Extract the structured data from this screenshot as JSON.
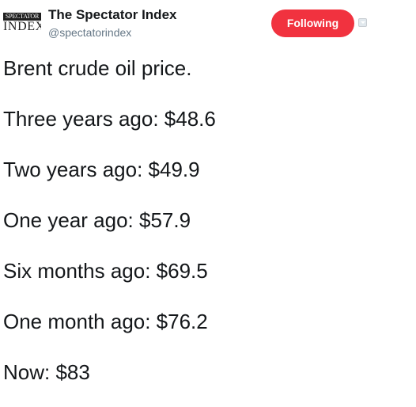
{
  "author": {
    "avatar_line1": "SPECTATOR",
    "avatar_line2": "INDEX",
    "display_name": "The Spectator Index",
    "handle": "@spectatorindex"
  },
  "follow_button": {
    "label": "Following",
    "color": "#f1323f"
  },
  "tweet": {
    "lines": [
      "Brent crude oil price.",
      "Three years ago: $48.6",
      "Two years ago: $49.9",
      "One year ago: $57.9",
      "Six months ago: $69.5",
      "One month ago: $76.2",
      "Now: $83"
    ]
  },
  "icons": {
    "menu": "chevron-down-icon"
  }
}
